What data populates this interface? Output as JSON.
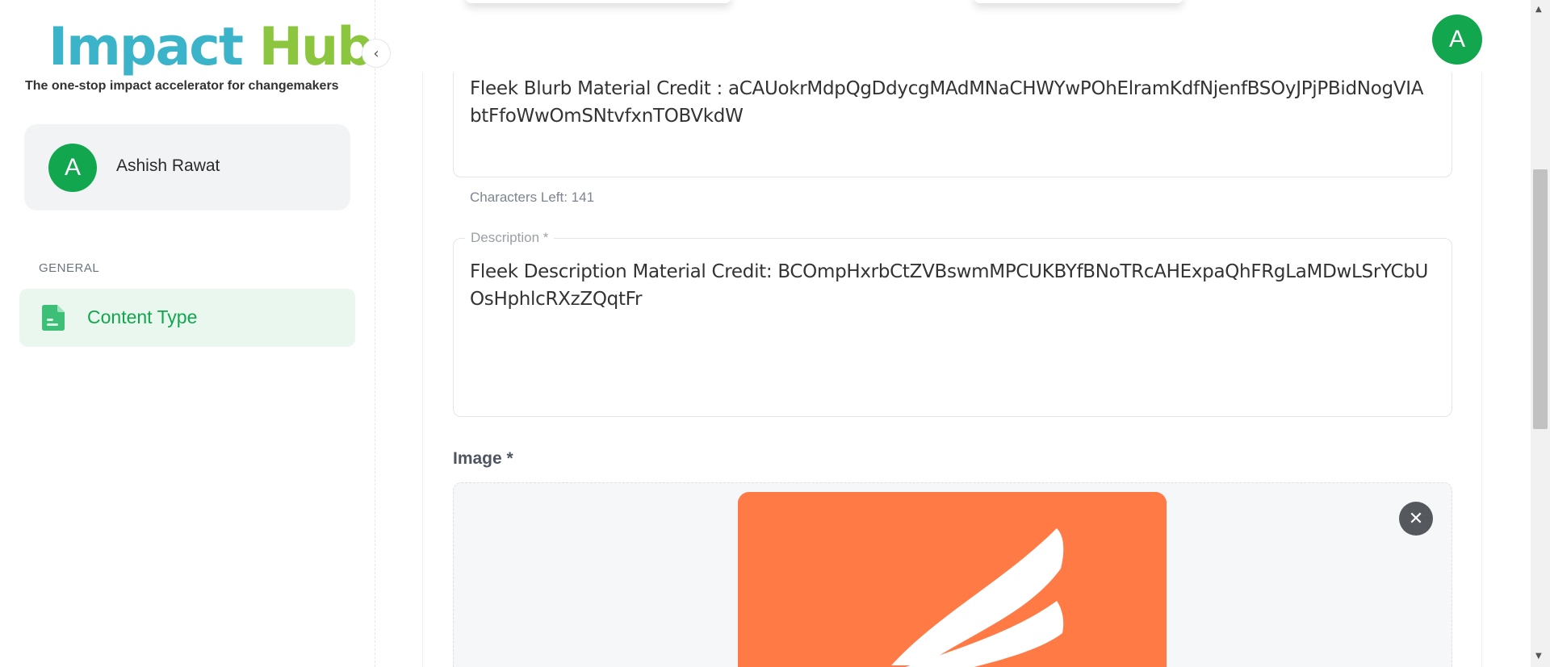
{
  "app": {
    "logo_word1": "Impact",
    "logo_word2": "Hub",
    "tagline": "The one-stop impact accelerator for changemakers"
  },
  "user": {
    "name": "Ashish Rawat",
    "initial": "A"
  },
  "sidebar": {
    "section_label": "GENERAL",
    "items": [
      {
        "label": "Content Type",
        "icon": "document-icon",
        "active": true
      }
    ]
  },
  "form": {
    "blurb_value": "Fleek Blurb Material Credit : aCAUokrMdpQgDdycgMAdMNaCHWYwPOhElramKdfNjenfBSOyJPjPBidNogVIAbtFfoWwOmSNtvfxnTOBVkdW",
    "characters_left": "Characters Left: 141",
    "description_label": "Description *",
    "description_value": "Fleek Description Material Credit: BCOmpHxrbCtZVBswmMPCUKBYfBNoTRcAHExpaQhFRgLaMDwLSrYCbUOsHphlcRXzZQqtFr",
    "image_label": "Image *"
  },
  "colors": {
    "brand_green": "#12a64f",
    "logo_teal": "#3bb4c9",
    "logo_lime": "#8cc63f",
    "image_orange": "#ff7a45"
  },
  "icons": {
    "collapse": "chevron-left-icon",
    "remove_image": "close-icon"
  }
}
